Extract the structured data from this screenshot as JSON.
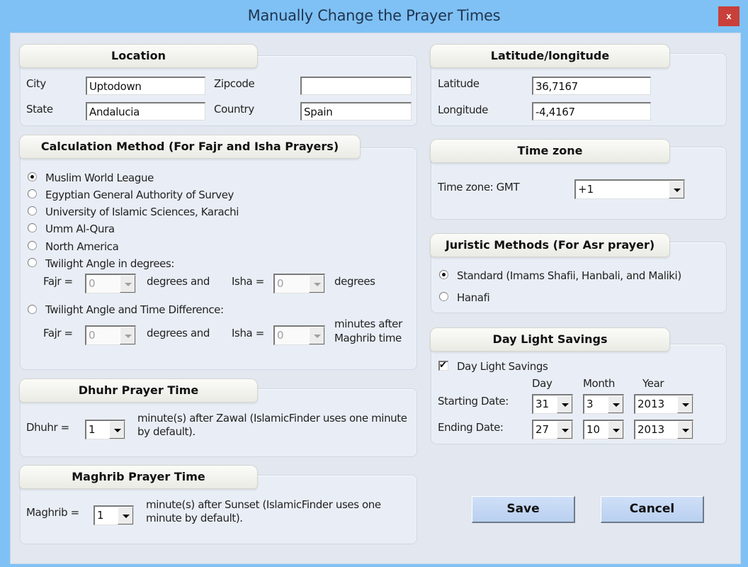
{
  "window": {
    "title": "Manually Change the Prayer Times",
    "close_label": "x"
  },
  "location": {
    "heading": "Location",
    "city_label": "City",
    "city_value": "Uptodown",
    "zipcode_label": "Zipcode",
    "zipcode_value": "",
    "state_label": "State",
    "state_value": "Andalucia",
    "country_label": "Country",
    "country_value": "Spain"
  },
  "calculation": {
    "heading": "Calculation Method (For Fajr and Isha Prayers)",
    "options": [
      {
        "label": "Muslim World League",
        "checked": true
      },
      {
        "label": "Egyptian General Authority of Survey",
        "checked": false
      },
      {
        "label": "University of Islamic Sciences, Karachi",
        "checked": false
      },
      {
        "label": "Umm Al-Qura",
        "checked": false
      },
      {
        "label": "North America",
        "checked": false
      },
      {
        "label": "Twilight Angle in degrees:",
        "checked": false
      },
      {
        "label": "Twilight Angle and Time Difference:",
        "checked": false
      }
    ],
    "twilight_angle": {
      "fajr_label": "Fajr =",
      "fajr_value": "0",
      "mid_label": "degrees and",
      "isha_label": "Isha =",
      "isha_value": "0",
      "end_label": "degrees"
    },
    "twilight_time": {
      "fajr_label": "Fajr =",
      "fajr_value": "0",
      "mid_label": "degrees and",
      "isha_label": "Isha =",
      "isha_value": "0",
      "end_label_1": "minutes after",
      "end_label_2": "Maghrib time"
    }
  },
  "dhuhr": {
    "heading": "Dhuhr Prayer Time",
    "label": "Dhuhr =",
    "value": "1",
    "desc_1": "minute(s) after Zawal  (IslamicFinder uses one minute",
    "desc_2": "by default)."
  },
  "maghrib": {
    "heading": "Maghrib Prayer Time",
    "label": "Maghrib =",
    "value": "1",
    "desc_1": "minute(s) after Sunset (IslamicFinder uses one",
    "desc_2": "minute by default)."
  },
  "latlong": {
    "heading": "Latitude/longitude",
    "latitude_label": "Latitude",
    "latitude_value": "36,7167",
    "longitude_label": "Longitude",
    "longitude_value": "-4,4167"
  },
  "timezone": {
    "heading": "Time zone",
    "label": "Time zone: GMT",
    "value": "+1"
  },
  "juristic": {
    "heading": "Juristic Methods (For Asr prayer)",
    "options": [
      {
        "label": "Standard (Imams Shafii, Hanbali, and Maliki)",
        "checked": true
      },
      {
        "label": "Hanafi",
        "checked": false
      }
    ]
  },
  "dst": {
    "heading": "Day Light Savings",
    "checkbox_label": "Day Light Savings",
    "checked": true,
    "col_day": "Day",
    "col_month": "Month",
    "col_year": "Year",
    "start_label": "Starting Date:",
    "start_day": "31",
    "start_month": "3",
    "start_year": "2013",
    "end_label": "Ending Date:",
    "end_day": "27",
    "end_month": "10",
    "end_year": "2013"
  },
  "actions": {
    "save_label": "Save",
    "cancel_label": "Cancel"
  }
}
